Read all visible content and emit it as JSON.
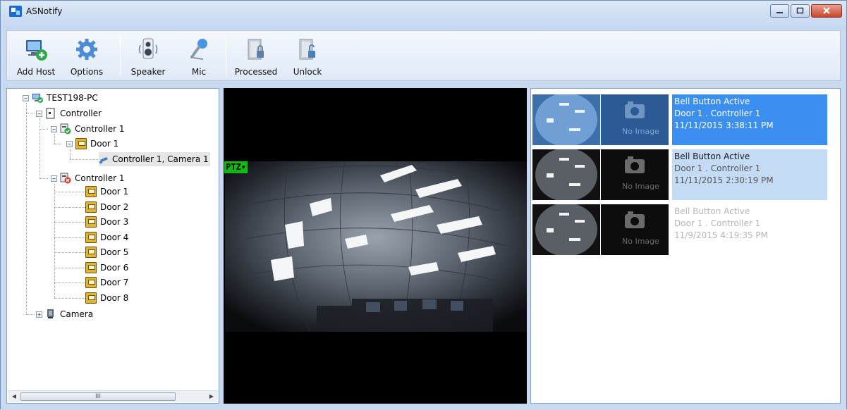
{
  "window": {
    "title": "ASNotify",
    "app_icon": "asnotify-icon",
    "controls": [
      "minimize-icon",
      "maximize-icon",
      "close-icon"
    ]
  },
  "toolbar": {
    "buttons": [
      {
        "label": "Add Host",
        "icon": "add-host-icon"
      },
      {
        "label": "Options",
        "icon": "gear-icon"
      },
      {
        "label": "Speaker",
        "icon": "speaker-icon"
      },
      {
        "label": "Mic",
        "icon": "microphone-icon"
      },
      {
        "label": "Processed",
        "icon": "processed-door-icon"
      },
      {
        "label": "Unlock",
        "icon": "unlock-door-icon"
      }
    ]
  },
  "tree": {
    "host": "TEST198-PC",
    "controller_group": "Controller",
    "controller_ok": {
      "label": "Controller 1",
      "door": "Door 1",
      "camera": "Controller 1, Camera 1"
    },
    "controller_err": {
      "label": "Controller 1",
      "doors": [
        "Door 1",
        "Door 2",
        "Door 3",
        "Door 4",
        "Door 5",
        "Door 6",
        "Door 7",
        "Door 8"
      ]
    },
    "camera_group": "Camera",
    "scrollbar_thumb": "III"
  },
  "video": {
    "ptz_label": "PTZ▾"
  },
  "events": [
    {
      "title": "Bell Button Active",
      "source": "Door 1 . Controller 1",
      "time": "11/11/2015 3:38:11 PM",
      "no_image": "No Image",
      "state": "selected"
    },
    {
      "title": "Bell Button Active",
      "source": "Door 1 . Controller 1",
      "time": "11/11/2015 2:30:19 PM",
      "no_image": "No Image",
      "state": "highlighted"
    },
    {
      "title": "Bell Button Active",
      "source": "Door 1 . Controller 1",
      "time": "11/9/2015 4:19:35 PM",
      "no_image": "No Image",
      "state": "processed"
    }
  ],
  "colors": {
    "selected": "#3b8ff0",
    "highlighted": "#c3dbf4",
    "ptz": "#13b913"
  }
}
